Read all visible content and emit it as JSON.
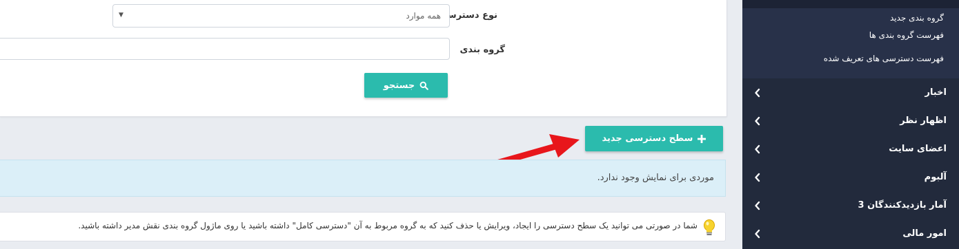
{
  "search": {
    "access_type_label": "نوع دسترسی",
    "access_type_value": "همه موارد",
    "group_label": "گروه بندی",
    "group_value": "",
    "search_button": "جستجو"
  },
  "actions": {
    "new_access_level": "سطح دسترسی جدید"
  },
  "info": {
    "empty_message": "موردی برای نمایش وجود ندارد."
  },
  "notice": {
    "text": "شما در صورتی می توانید یک سطح دسترسی را ایجاد، ویرایش یا حذف کنید که به گروه مربوط به آن \"دسترسی کامل\" داشته باشید یا روی ماژول گروه بندی نقش مدیر داشته باشید."
  },
  "sidebar": {
    "submenu": [
      {
        "label": "گروه بندی جدید"
      },
      {
        "label": "فهرست گروه بندی ها"
      },
      {
        "label": "فهرست دسترسی های تعریف شده"
      }
    ],
    "items": [
      {
        "label": "اخبار"
      },
      {
        "label": "اظهار نظر"
      },
      {
        "label": "اعضای سایت"
      },
      {
        "label": "آلبوم"
      },
      {
        "label": "آمار بازدیدکنندگان 3"
      },
      {
        "label": "امور مالی"
      }
    ]
  },
  "colors": {
    "accent": "#2bbbad",
    "sidebar_bg": "#222a3c",
    "sidebar_submenu_bg": "#283149",
    "info_bg": "#dbeff8",
    "arrow": "#e8161b"
  },
  "icons": {
    "search_button_icon": "search-icon",
    "new_button_icon": "plus-icon",
    "notice_icon": "lightbulb-icon",
    "sidebar_item_icon": "chevron-left-icon",
    "select_icon": "caret-down-icon"
  }
}
